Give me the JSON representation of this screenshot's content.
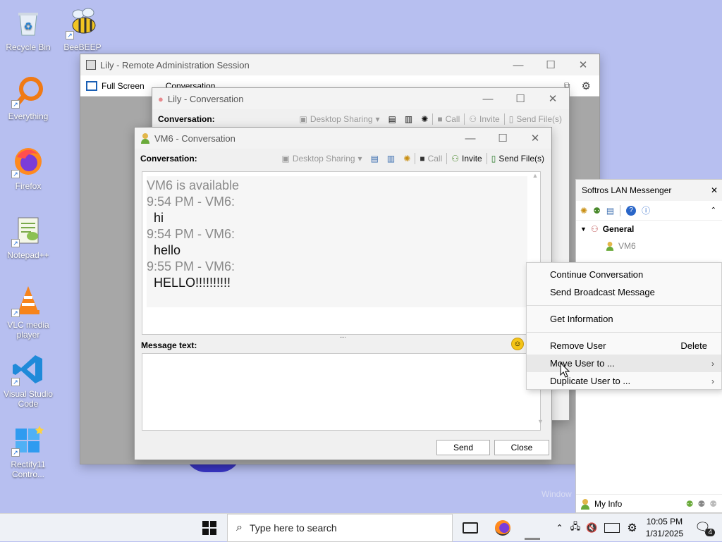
{
  "desktop": {
    "icons": [
      {
        "label": "Recycle Bin",
        "icon": "recycle-bin-icon"
      },
      {
        "label": "BeeBEEP",
        "icon": "bee-icon"
      },
      {
        "label": "Everything",
        "icon": "everything-search-icon"
      },
      {
        "label": "Firefox",
        "icon": "firefox-icon"
      },
      {
        "label": "Notepad++",
        "icon": "notepad-plus-icon"
      },
      {
        "label": "VLC media player",
        "icon": "vlc-cone-icon"
      },
      {
        "label": "Visual Studio Code",
        "icon": "vscode-icon"
      },
      {
        "label": "Rectify11 Contro...",
        "icon": "rectify11-icon"
      }
    ],
    "watermark": "Window"
  },
  "remote_window": {
    "title": "Lily - Remote Administration Session",
    "full_screen_label": "Full Screen",
    "conversation_label": "Conversation"
  },
  "lily_conv": {
    "title": "Lily - Conversation",
    "conversation_label": "Conversation:",
    "toolbar": {
      "desktop_sharing": "Desktop Sharing",
      "call": "Call",
      "invite": "Invite",
      "send_files": "Send File(s)"
    }
  },
  "vm6_conv": {
    "title": "VM6 - Conversation",
    "conversation_label": "Conversation:",
    "toolbar": {
      "desktop_sharing": "Desktop Sharing",
      "call": "Call",
      "invite": "Invite",
      "send_files": "Send File(s)"
    },
    "messages": [
      {
        "kind": "status",
        "text": "VM6 is available"
      },
      {
        "kind": "header",
        "text": "9:54 PM - VM6:"
      },
      {
        "kind": "body",
        "text": "hi"
      },
      {
        "kind": "header",
        "text": "9:54 PM - VM6:"
      },
      {
        "kind": "body",
        "text": "hello"
      },
      {
        "kind": "header",
        "text": "9:55 PM - VM6:"
      },
      {
        "kind": "body",
        "text": "HELLO!!!!!!!!!!"
      }
    ],
    "message_text_label": "Message text:",
    "input_value": "",
    "send_label": "Send",
    "close_label": "Close"
  },
  "messenger": {
    "title": "Softros LAN Messenger",
    "group": "General",
    "user": "VM6",
    "my_info": "My Info"
  },
  "context_menu": {
    "items": [
      {
        "label": "Continue Conversation",
        "shortcut": "",
        "submenu": false
      },
      {
        "label": "Send Broadcast Message",
        "shortcut": "",
        "submenu": false
      },
      {
        "label": "Get Information",
        "shortcut": "",
        "submenu": false
      },
      {
        "label": "Remove User",
        "shortcut": "Delete",
        "submenu": false
      },
      {
        "label": "Move User to ...",
        "shortcut": "",
        "submenu": true
      },
      {
        "label": "Duplicate User to ...",
        "shortcut": "",
        "submenu": true
      }
    ]
  },
  "taskbar": {
    "search_placeholder": "Type here to search",
    "time": "10:05 PM",
    "date": "1/31/2025",
    "notification_count": "4"
  },
  "colors": {
    "accent": "#0b58c4",
    "desktop": "#b7bff0",
    "selection": "#e5e5e5"
  }
}
